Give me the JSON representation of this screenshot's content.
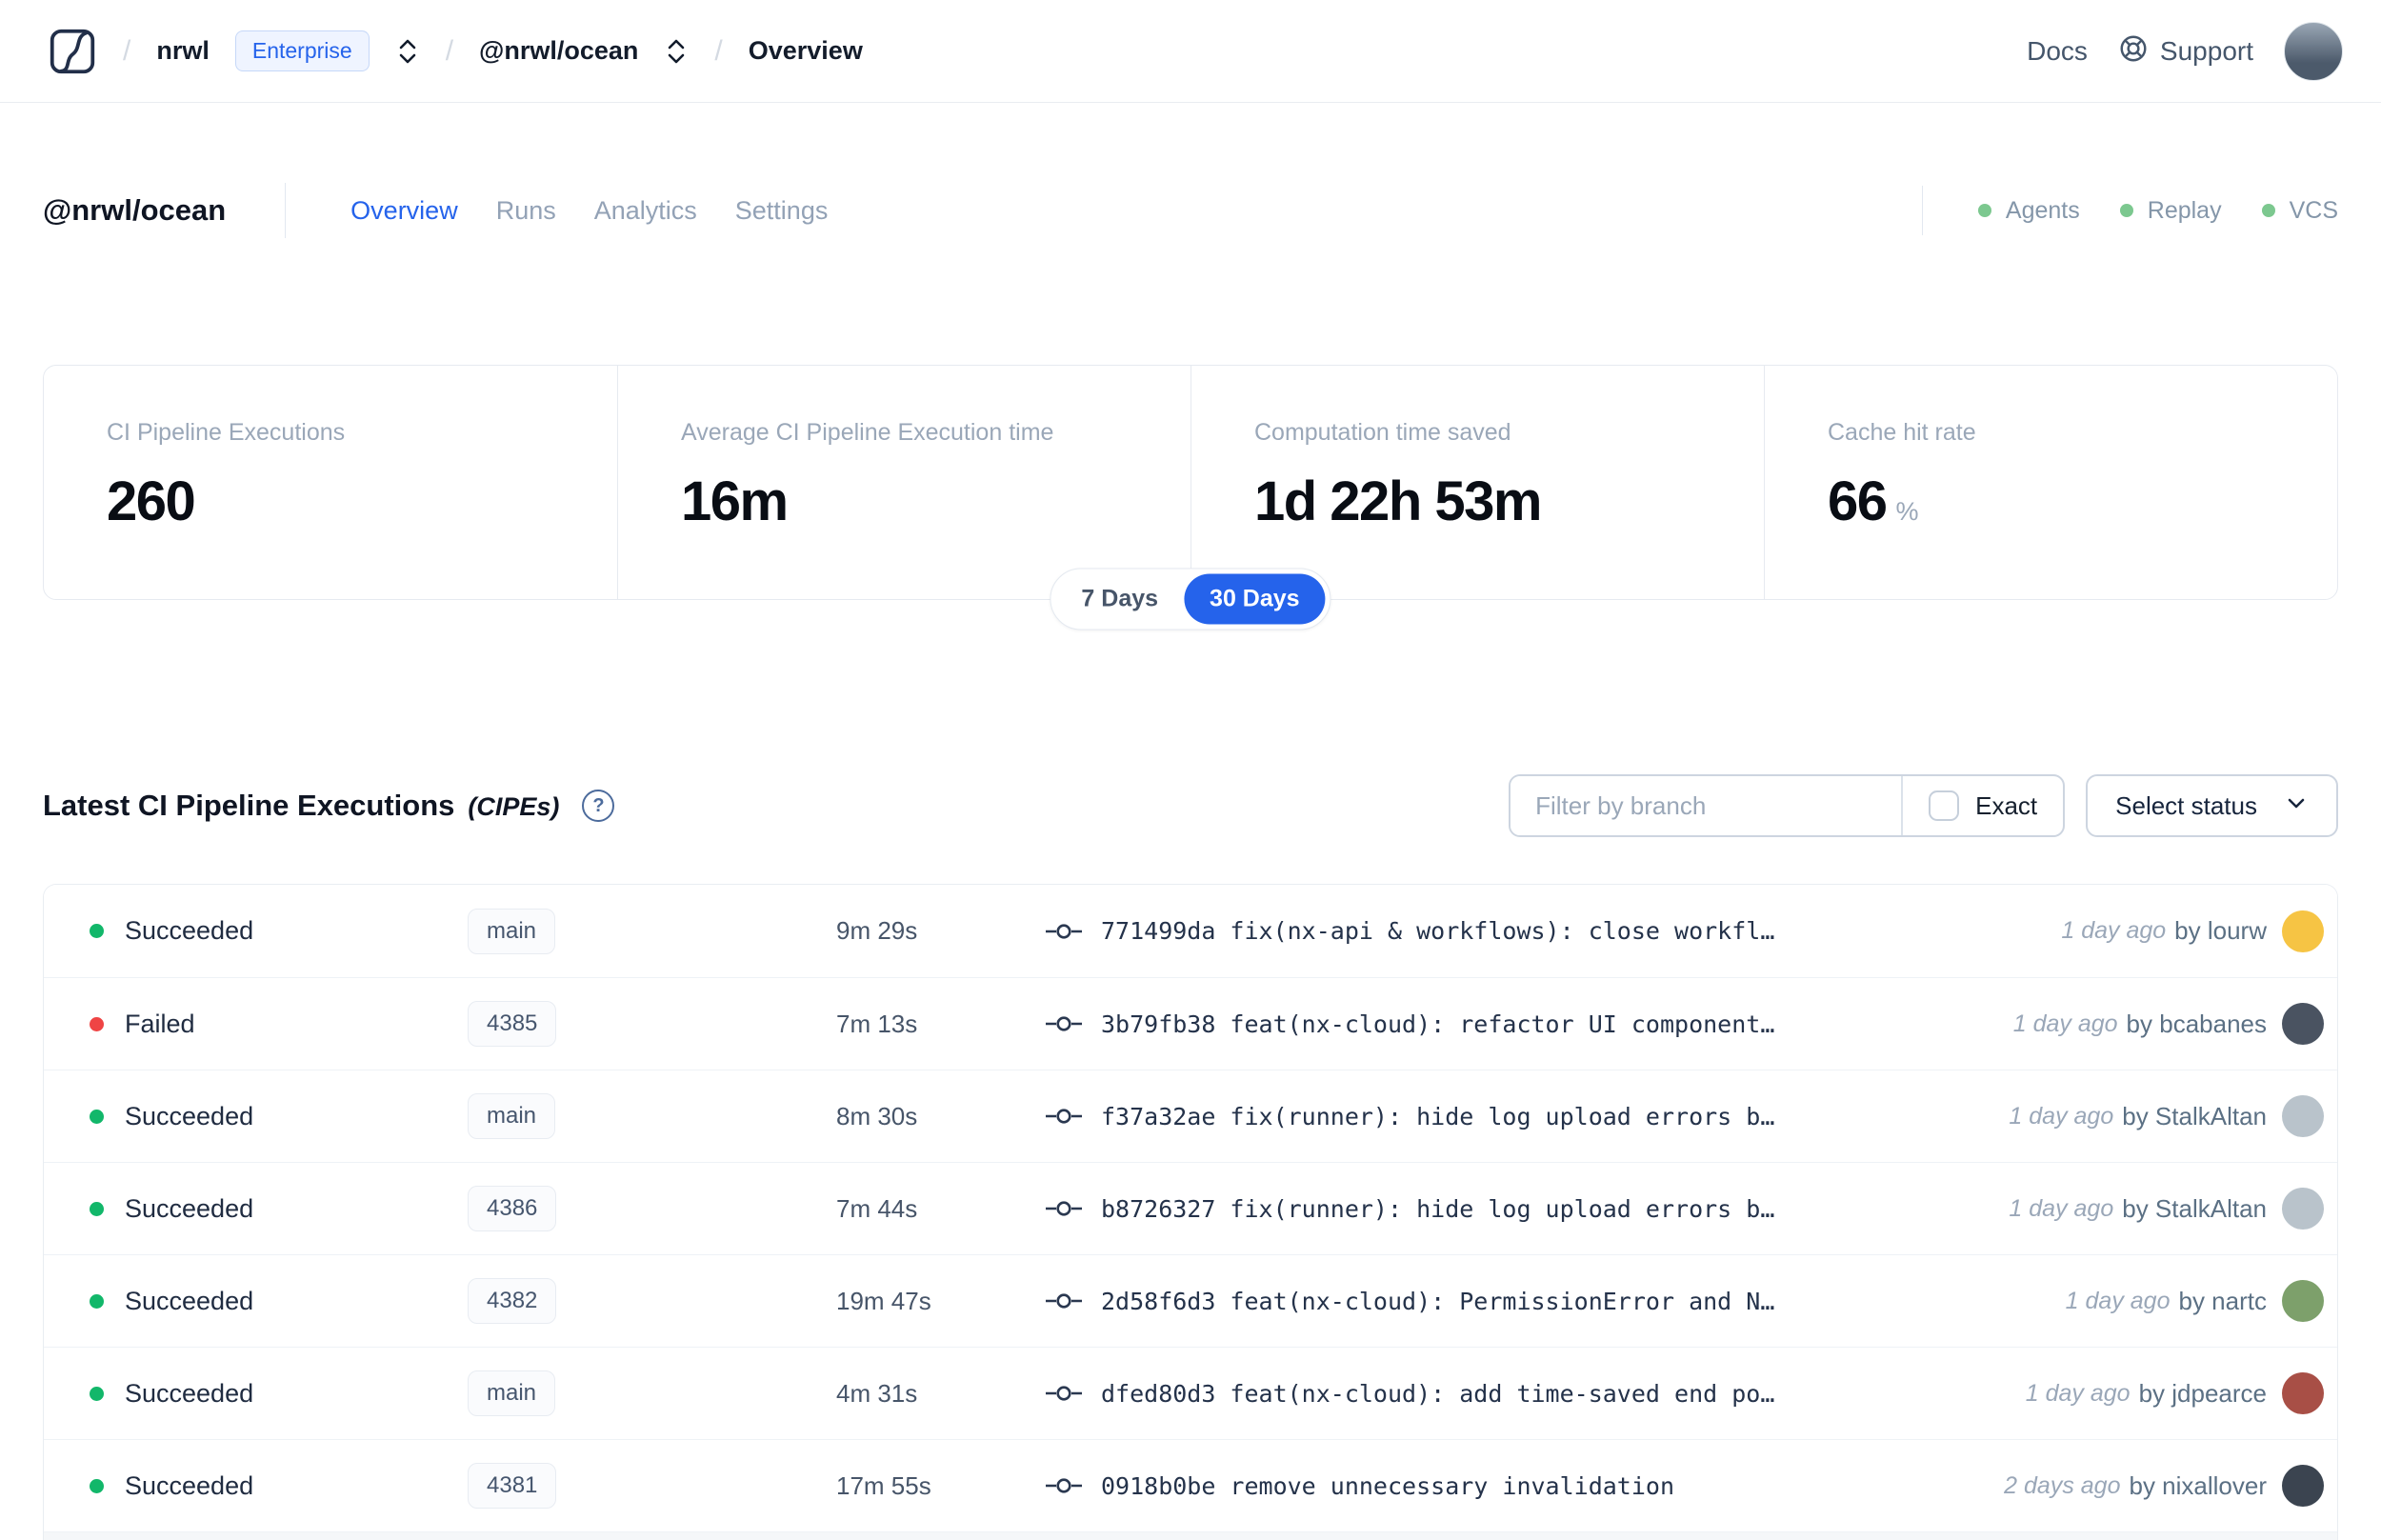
{
  "topbar": {
    "breadcrumb": {
      "org": "nrwl",
      "org_badge": "Enterprise",
      "workspace": "@nrwl/ocean",
      "page": "Overview"
    },
    "docs_label": "Docs",
    "support_label": "Support"
  },
  "header": {
    "title": "@nrwl/ocean",
    "tabs": [
      {
        "label": "Overview",
        "active": true
      },
      {
        "label": "Runs",
        "active": false
      },
      {
        "label": "Analytics",
        "active": false
      },
      {
        "label": "Settings",
        "active": false
      }
    ],
    "statuses": [
      {
        "label": "Agents",
        "color": "#7cc88f"
      },
      {
        "label": "Replay",
        "color": "#7cc88f"
      },
      {
        "label": "VCS",
        "color": "#7cc88f"
      }
    ]
  },
  "stats": {
    "cards": [
      {
        "label": "CI Pipeline Executions",
        "value": "260",
        "suffix": ""
      },
      {
        "label": "Average CI Pipeline Execution time",
        "value": "16m",
        "suffix": ""
      },
      {
        "label": "Computation time saved",
        "value": "1d 22h 53m",
        "suffix": ""
      },
      {
        "label": "Cache hit rate",
        "value": "66",
        "suffix": "%"
      }
    ],
    "range_toggle": {
      "options": [
        "7 Days",
        "30 Days"
      ],
      "selected": "30 Days",
      "active_color": "#2563eb"
    }
  },
  "cipe_section": {
    "title": "Latest CI Pipeline Executions",
    "title_suffix": "(CIPEs)",
    "help_icon": "?",
    "filter_placeholder": "Filter by branch",
    "exact_label": "Exact",
    "exact_checked": false,
    "status_select_label": "Select status",
    "status_colors": {
      "succeeded": "#12b76a",
      "failed": "#ef4444"
    },
    "rows": [
      {
        "status": "Succeeded",
        "status_type": "succeeded",
        "branch": "main",
        "duration": "9m 29s",
        "commit_hash": "771499da",
        "commit_message": "fix(nx-api & workflows): close workfl…",
        "time_ago": "1 day ago",
        "author": "by lourw",
        "avatar_color": "#f6c444"
      },
      {
        "status": "Failed",
        "status_type": "failed",
        "branch": "4385",
        "duration": "7m 13s",
        "commit_hash": "3b79fb38",
        "commit_message": "feat(nx-cloud): refactor UI component…",
        "time_ago": "1 day ago",
        "author": "by bcabanes",
        "avatar_color": "#4a5361"
      },
      {
        "status": "Succeeded",
        "status_type": "succeeded",
        "branch": "main",
        "duration": "8m 30s",
        "commit_hash": "f37a32ae",
        "commit_message": "fix(runner): hide log upload errors b…",
        "time_ago": "1 day ago",
        "author": "by StalkAltan",
        "avatar_color": "#b9c3cb"
      },
      {
        "status": "Succeeded",
        "status_type": "succeeded",
        "branch": "4386",
        "duration": "7m 44s",
        "commit_hash": "b8726327",
        "commit_message": "fix(runner): hide log upload errors b…",
        "time_ago": "1 day ago",
        "author": "by StalkAltan",
        "avatar_color": "#b9c3cb"
      },
      {
        "status": "Succeeded",
        "status_type": "succeeded",
        "branch": "4382",
        "duration": "19m 47s",
        "commit_hash": "2d58f6d3",
        "commit_message": "feat(nx-cloud): PermissionError and N…",
        "time_ago": "1 day ago",
        "author": "by nartc",
        "avatar_color": "#7da06b"
      },
      {
        "status": "Succeeded",
        "status_type": "succeeded",
        "branch": "main",
        "duration": "4m 31s",
        "commit_hash": "dfed80d3",
        "commit_message": "feat(nx-cloud): add time-saved end po…",
        "time_ago": "1 day ago",
        "author": "by jdpearce",
        "avatar_color": "#a84f46"
      },
      {
        "status": "Succeeded",
        "status_type": "succeeded",
        "branch": "4381",
        "duration": "17m 55s",
        "commit_hash": "0918b0be",
        "commit_message": "remove unnecessary invalidation",
        "time_ago": "2 days ago",
        "author": "by nixallover",
        "avatar_color": "#3b4450"
      }
    ]
  }
}
